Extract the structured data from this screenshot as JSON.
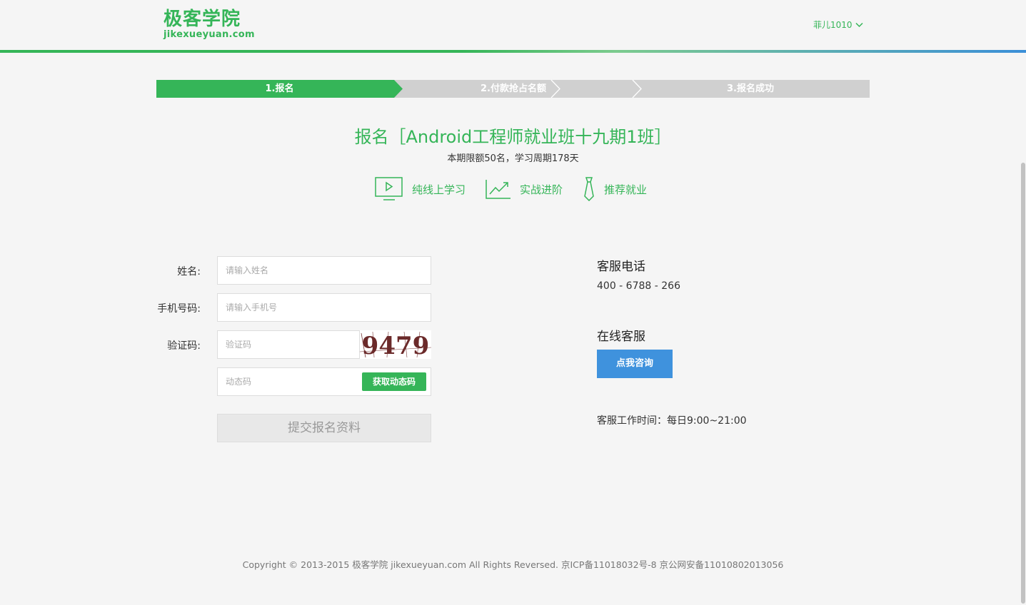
{
  "header": {
    "logo_cn": "极客学院",
    "logo_en": "jikexueyuan.com",
    "user_name": "菲儿1010"
  },
  "steps": [
    {
      "label": "1.报名",
      "active": true
    },
    {
      "label": "2.付款抢占名额",
      "active": false
    },
    {
      "label": "3.报名成功",
      "active": false
    }
  ],
  "course": {
    "title": "报名［Android工程师就业班十九期1班］",
    "subtitle": "本期限额50名，学习周期178天"
  },
  "features": [
    {
      "icon": "monitor-play-icon",
      "label": "纯线上学习"
    },
    {
      "icon": "trend-chart-icon",
      "label": "实战进阶"
    },
    {
      "icon": "tie-icon",
      "label": "推荐就业"
    }
  ],
  "form": {
    "name_label": "姓名:",
    "name_placeholder": "请输入姓名",
    "phone_label": "手机号码:",
    "phone_placeholder": "请输入手机号",
    "captcha_label": "验证码:",
    "captcha_placeholder": "验证码",
    "captcha_text": "9479",
    "dynamic_placeholder": "动态码",
    "dynamic_button": "获取动态码",
    "submit": "提交报名资料"
  },
  "service": {
    "phone_title": "客服电话",
    "phone": "400 - 6788 - 266",
    "online_title": "在线客服",
    "consult_button": "点我咨询",
    "hours": "客服工作时间：每日9:00~21:00"
  },
  "footer": "Copyright © 2013-2015 极客学院 jikexueyuan.com All Rights Reversed. 京ICP备11018032号-8 京公网安备11010802013056",
  "colors": {
    "brand_green": "#35b558",
    "consult_blue": "#3f92dd",
    "step_gray": "#d0d0d0"
  }
}
